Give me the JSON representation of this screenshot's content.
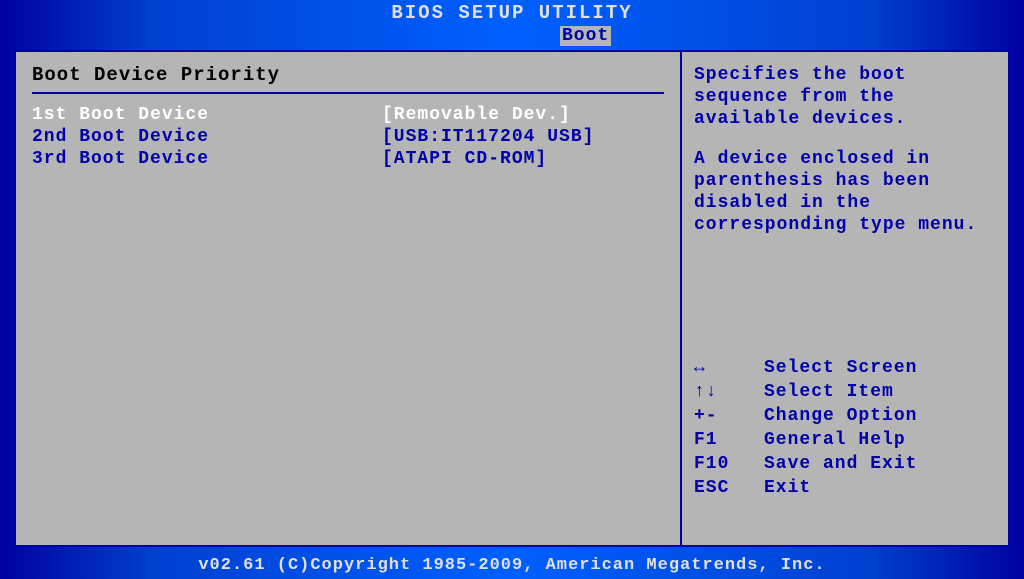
{
  "title": "BIOS SETUP UTILITY",
  "active_tab": "Boot",
  "main": {
    "section_title": "Boot Device Priority",
    "items": [
      {
        "label": "1st Boot Device",
        "value": "[Removable Dev.]",
        "selected": true
      },
      {
        "label": "2nd Boot Device",
        "value": "[USB:IT117204 USB]",
        "selected": false
      },
      {
        "label": "3rd Boot Device",
        "value": "[ATAPI CD-ROM]",
        "selected": false
      }
    ]
  },
  "help": {
    "p1": "Specifies the boot sequence from the available devices.",
    "p2": "A device enclosed in parenthesis has been disabled in the corresponding type menu."
  },
  "keyhints": [
    {
      "key": "↔",
      "action": "Select Screen"
    },
    {
      "key": "↑↓",
      "action": "Select Item"
    },
    {
      "key": "+-",
      "action": "Change Option"
    },
    {
      "key": "F1",
      "action": "General Help"
    },
    {
      "key": "F10",
      "action": "Save and Exit"
    },
    {
      "key": "ESC",
      "action": "Exit"
    }
  ],
  "footer": "v02.61 (C)Copyright 1985-2009, American Megatrends, Inc."
}
